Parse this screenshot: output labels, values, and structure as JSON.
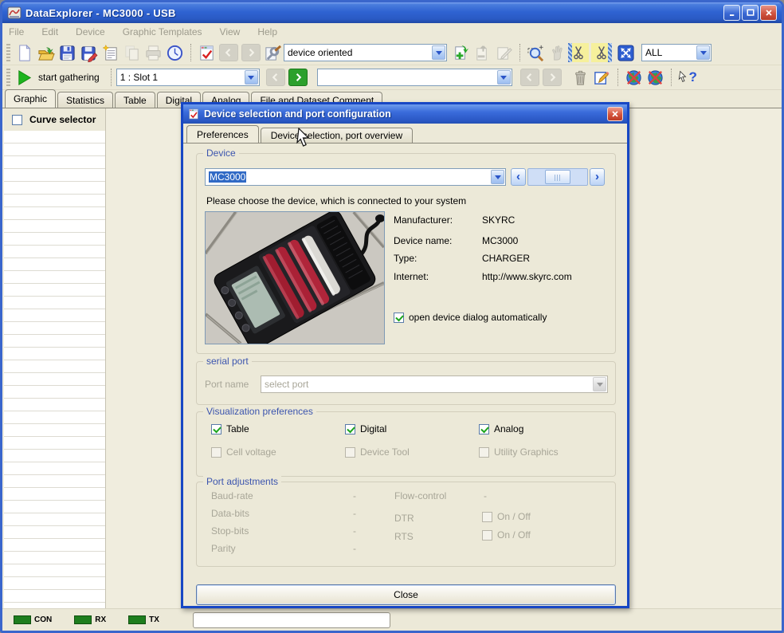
{
  "window": {
    "title": "DataExplorer  -  MC3000  -  USB"
  },
  "menu": {
    "items": [
      {
        "label": "File"
      },
      {
        "label": "Edit"
      },
      {
        "label": "Device"
      },
      {
        "label": "Graphic Templates"
      },
      {
        "label": "View"
      },
      {
        "label": "Help"
      }
    ]
  },
  "toolbar": {
    "device_oriented_value": "device oriented",
    "scope_value": "ALL",
    "start_gathering_label": "start gathering",
    "slot_value": "1 : Slot 1",
    "record_value": ""
  },
  "tabs": {
    "items": [
      {
        "label": "Graphic",
        "active": true
      },
      {
        "label": "Statistics"
      },
      {
        "label": "Table"
      },
      {
        "label": "Digital"
      },
      {
        "label": "Analog"
      },
      {
        "label": "File and Dataset Comment"
      }
    ]
  },
  "curve_selector": {
    "label": "Curve selector"
  },
  "status": {
    "indicators": [
      {
        "label": "CON"
      },
      {
        "label": "RX"
      },
      {
        "label": "TX"
      }
    ],
    "message": ""
  },
  "dialog": {
    "title": "Device selection and port configuration",
    "tabs": [
      {
        "label": "Preferences",
        "active": true
      },
      {
        "label": "Device selection, port overview"
      }
    ],
    "device": {
      "label": "Device",
      "combo_value": "MC3000",
      "prompt": "Please choose the device, which is connected to your system",
      "info": [
        {
          "label": "Manufacturer:",
          "value": "SKYRC"
        },
        {
          "label": "Device name:",
          "value": "MC3000"
        },
        {
          "label": "Type:",
          "value": "CHARGER"
        },
        {
          "label": "Internet:",
          "value": "http://www.skyrc.com"
        }
      ],
      "auto_open_label": "open device dialog automatically",
      "auto_open_checked": true
    },
    "serial": {
      "label": "serial port",
      "port_name_label": "Port name",
      "port_value": "select port"
    },
    "viz": {
      "label": "Visualization preferences",
      "items": [
        {
          "label": "Table",
          "checked": true,
          "enabled": true
        },
        {
          "label": "Digital",
          "checked": true,
          "enabled": true
        },
        {
          "label": "Analog",
          "checked": true,
          "enabled": true
        },
        {
          "label": "Cell voltage",
          "checked": false,
          "enabled": false
        },
        {
          "label": "Device Tool",
          "checked": false,
          "enabled": false
        },
        {
          "label": "Utility Graphics",
          "checked": false,
          "enabled": false
        }
      ]
    },
    "port": {
      "label": "Port adjustments",
      "rows_left": [
        {
          "label": "Baud-rate",
          "value": "-"
        },
        {
          "label": "Data-bits",
          "value": "-"
        },
        {
          "label": "Stop-bits",
          "value": "-"
        },
        {
          "label": "Parity",
          "value": "-"
        }
      ],
      "flow_control": {
        "label": "Flow-control",
        "value": "-"
      },
      "dtr": {
        "label": "DTR",
        "value": "On / Off",
        "checked": false
      },
      "rts": {
        "label": "RTS",
        "value": "On / Off",
        "checked": false
      }
    },
    "close_label": "Close"
  },
  "colors": {
    "titlebar_blue": "#2f63d2",
    "dialog_border": "#1747c4",
    "selection_blue": "#316ac5",
    "group_label_blue": "#3c55ae",
    "status_led_green": "#1e7e1e",
    "accent_green": "#1db41d"
  }
}
